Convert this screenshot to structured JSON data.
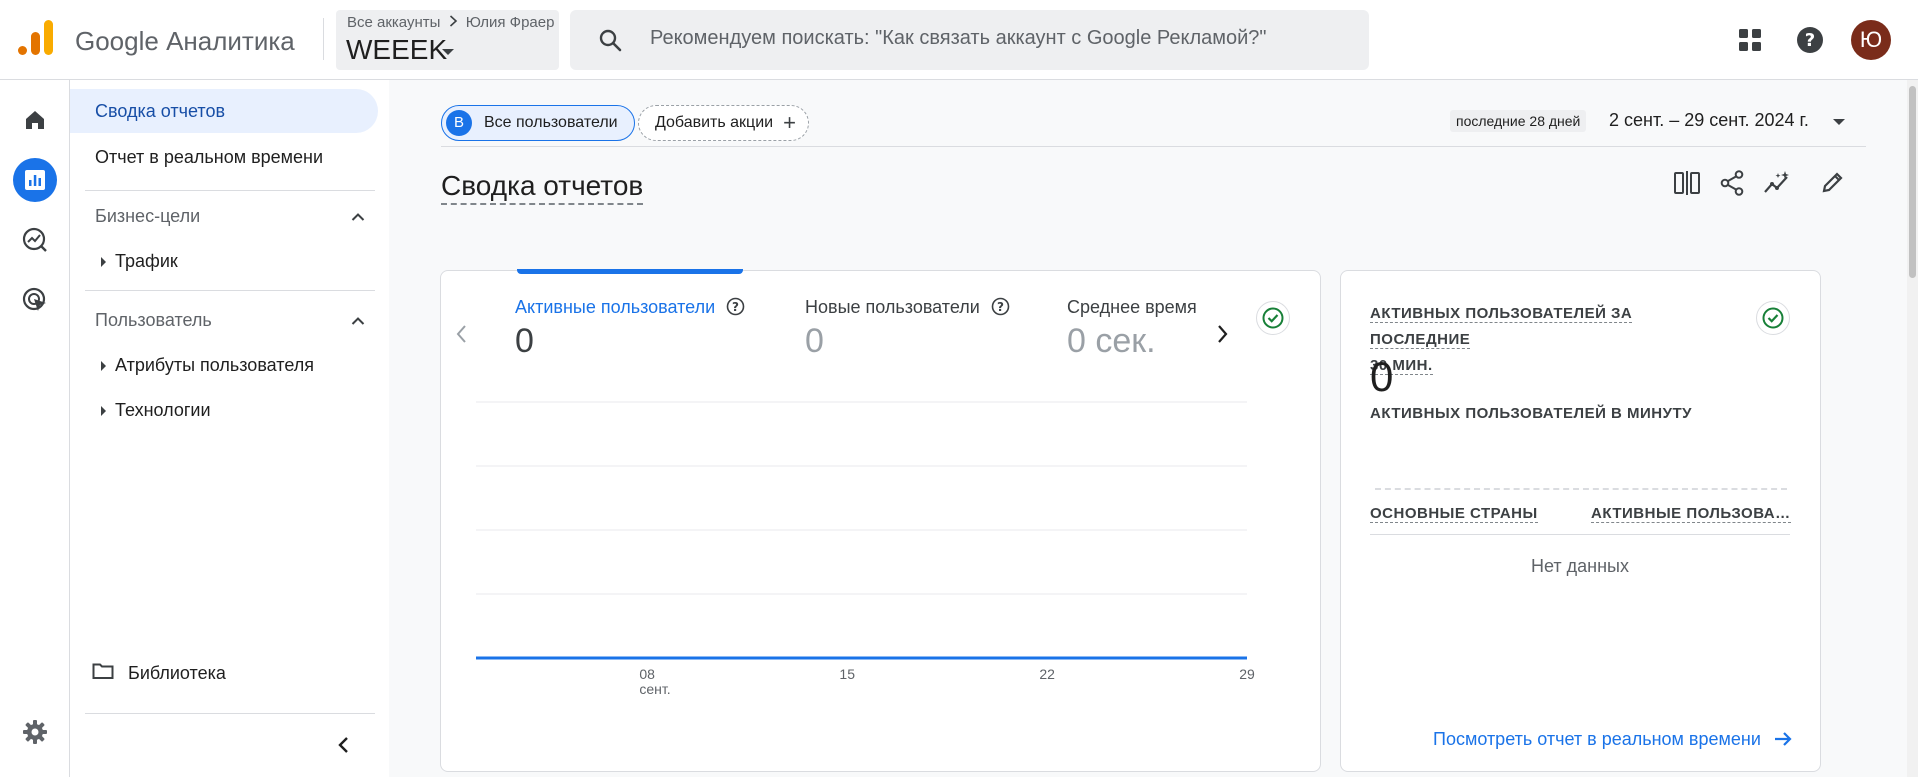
{
  "app": {
    "title": "Google Аналитика"
  },
  "account": {
    "breadcrumb_root": "Все аккаунты",
    "breadcrumb_account": "Юлия Фраер",
    "property": "WEEEK"
  },
  "search": {
    "placeholder": "Рекомендуем поискать: \"Как связать аккаунт с Google Рекламой?\""
  },
  "user": {
    "avatar_initial": "Ю"
  },
  "nav": {
    "items": [
      {
        "label": "Сводка отчетов"
      },
      {
        "label": "Отчет в реальном времени"
      }
    ],
    "sections": [
      {
        "label": "Бизнес-цели",
        "children": [
          "Трафик"
        ]
      },
      {
        "label": "Пользователь",
        "children": [
          "Атрибуты пользователя",
          "Технологии"
        ]
      }
    ],
    "library": "Библиотека"
  },
  "filters": {
    "segment_badge": "В",
    "segment_label": "Все пользователи",
    "add_comparison": "Добавить акции",
    "date_tag": "последние 28 дней",
    "date_range": "2 сент. – 29 сент. 2024 г."
  },
  "page": {
    "title": "Сводка отчетов"
  },
  "metrics": [
    {
      "label": "Активные пользователи",
      "value": "0"
    },
    {
      "label": "Новые пользователи",
      "value": "0"
    },
    {
      "label": "Среднее время",
      "value": "0 сек."
    }
  ],
  "chart_data": {
    "type": "line",
    "x": [
      "02",
      "03",
      "04",
      "05",
      "06",
      "07",
      "08",
      "09",
      "10",
      "11",
      "12",
      "13",
      "14",
      "15",
      "16",
      "17",
      "18",
      "19",
      "20",
      "21",
      "22",
      "23",
      "24",
      "25",
      "26",
      "27",
      "28",
      "29"
    ],
    "tick_labels": [
      {
        "day": "08",
        "month": "сент."
      },
      {
        "day": "15",
        "month": ""
      },
      {
        "day": "22",
        "month": ""
      },
      {
        "day": "29",
        "month": ""
      }
    ],
    "series": [
      {
        "values": [
          0,
          0,
          0,
          0,
          0,
          0,
          0,
          0,
          0,
          0,
          0,
          0,
          0,
          0,
          0,
          0,
          0,
          0,
          0,
          0,
          0,
          0,
          0,
          0,
          0,
          0,
          0,
          0
        ],
        "color": "#1a73e8"
      }
    ],
    "grid": true,
    "legend": "none"
  },
  "realtime": {
    "heading_line1": "АКТИВНЫХ ПОЛЬЗОВАТЕЛЕЙ ЗА ПОСЛЕДНИЕ",
    "heading_line2": "30 МИН.",
    "value": "0",
    "subheading": "АКТИВНЫХ ПОЛЬЗОВАТЕЛЕЙ В МИНУТУ",
    "col_country": "ОСНОВНЫЕ СТРАНЫ",
    "col_users": "АКТИВНЫЕ ПОЛЬЗОВА…",
    "empty": "Нет данных",
    "link": "Посмотреть отчет в реальном времени"
  },
  "colors": {
    "accent": "#1a73e8",
    "success": "#188038",
    "logo_orange": "#e37400",
    "logo_yellow": "#f9ab00"
  }
}
